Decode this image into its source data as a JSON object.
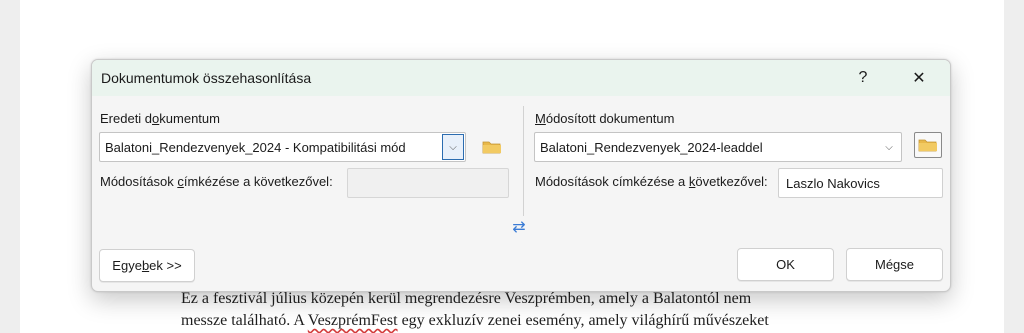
{
  "dialog": {
    "title": "Dokumentumok összehasonlítása",
    "help_label": "?",
    "close_label": "✕",
    "left": {
      "label_pre": "Eredeti d",
      "label_u": "o",
      "label_post": "kumentum",
      "combo_value": "Balatoni_Rendezvenyek_2024  -  Kompatibilitási mód",
      "label_changes_pre": "Módosítások ",
      "label_changes_u": "c",
      "label_changes_post": "ímkézése a következővel:",
      "changes_value": ""
    },
    "right": {
      "label_u": "M",
      "label_post": "ódosított dokumentum",
      "combo_value": "Balatoni_Rendezvenyek_2024-leaddel",
      "label_changes_pre": "Módosítások címkézése a ",
      "label_changes_u": "k",
      "label_changes_post": "övetkezővel:",
      "changes_value": "Laszlo Nakovics"
    },
    "swap_icon": "⇄",
    "more_button_pre": "Egye",
    "more_button_u": "b",
    "more_button_post": "ek >>",
    "ok_label": "OK",
    "cancel_label": "Mégse"
  },
  "document": {
    "line1": "Ez a fesztivál július közepén kerül megrendezésre Veszprémben, amely a Balatontól nem",
    "line2_pre": "messze található. A ",
    "line2_flag": "VeszprémFest",
    "line2_post": " egy exkluzív zenei esemény, amely világhírű művészeket"
  },
  "colors": {
    "titlebar": "#eaf4ee",
    "accent": "#3a7bd5",
    "folder": "#e8b84a"
  }
}
